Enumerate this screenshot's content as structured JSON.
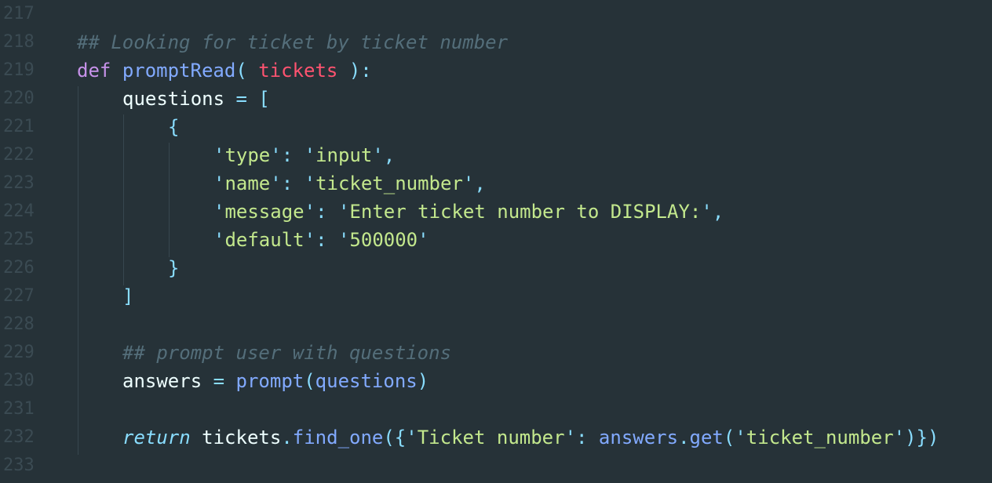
{
  "editor": {
    "line_numbers": [
      "217",
      "218",
      "219",
      "220",
      "221",
      "222",
      "223",
      "224",
      "225",
      "226",
      "227",
      "228",
      "229",
      "230",
      "231",
      "232",
      "233"
    ],
    "lines": {
      "l218": {
        "comment": "## Looking for ticket by ticket number"
      },
      "l219": {
        "def": "def",
        "name": "promptRead",
        "open": "(",
        "param": "tickets",
        "close": "):"
      },
      "l220": {
        "var": "questions",
        "eq": "=",
        "bracket": "["
      },
      "l221": {
        "brace": "{"
      },
      "l222": {
        "q1": "'",
        "key": "type",
        "q2": "'",
        "colon": ":",
        "q3": "'",
        "val": "input",
        "q4": "'",
        "comma": ","
      },
      "l223": {
        "q1": "'",
        "key": "name",
        "q2": "'",
        "colon": ":",
        "q3": "'",
        "val": "ticket_number",
        "q4": "'",
        "comma": ","
      },
      "l224": {
        "q1": "'",
        "key": "message",
        "q2": "'",
        "colon": ":",
        "q3": "'",
        "val": "Enter ticket number to DISPLAY:",
        "q4": "'",
        "comma": ","
      },
      "l225": {
        "q1": "'",
        "key": "default",
        "q2": "'",
        "colon": ":",
        "q3": "'",
        "val": "500000",
        "q4": "'"
      },
      "l226": {
        "brace": "}"
      },
      "l227": {
        "bracket": "]"
      },
      "l229": {
        "comment": "## prompt user with questions"
      },
      "l230": {
        "var": "answers",
        "eq": "=",
        "func": "prompt",
        "open": "(",
        "arg": "questions",
        "close": ")"
      },
      "l232": {
        "ret": "return",
        "obj": "tickets",
        "dot1": ".",
        "method": "find_one",
        "open": "({",
        "q1": "'",
        "key": "Ticket number",
        "q2": "'",
        "colon": ":",
        "obj2": "answers",
        "dot2": ".",
        "method2": "get",
        "open2": "(",
        "q3": "'",
        "arg": "ticket_number",
        "q4": "'",
        "close": ")})"
      }
    }
  },
  "colors": {
    "background": "#263238",
    "comment": "#546e7a",
    "keyword": "#c792ea",
    "function": "#82aaff",
    "parameter": "#ff5370",
    "punctuation": "#89ddff",
    "string": "#c3e88d",
    "text": "#eeffff",
    "gutter": "#3b4b53"
  }
}
